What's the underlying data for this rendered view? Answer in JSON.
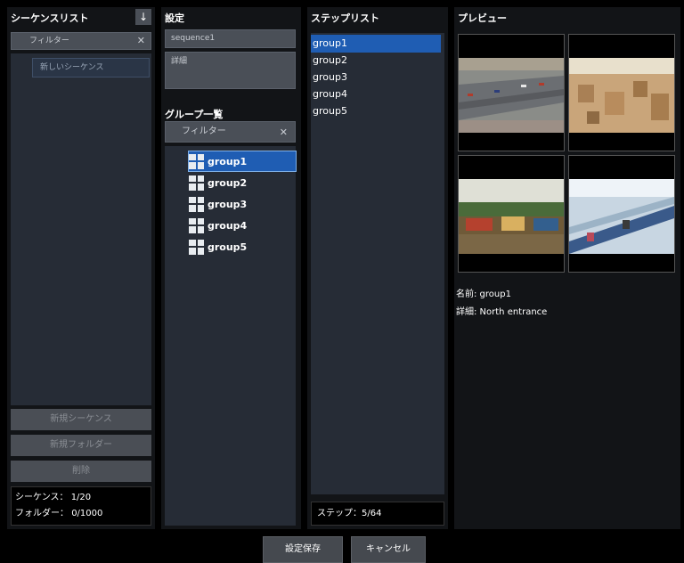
{
  "sequence_panel": {
    "title": "シーケンスリスト",
    "filter_placeholder": "フィルター",
    "new_sequence_item": "新しいシーケンス",
    "btn_new_sequence": "新規シーケンス",
    "btn_new_folder": "新規フォルダー",
    "btn_delete": "削除",
    "sequence_count_label": "シーケンス：",
    "sequence_count": "1/20",
    "folder_count_label": "フォルダー：",
    "folder_count": "0/1000"
  },
  "settings_panel": {
    "title": "設定",
    "name_value": "sequence1",
    "detail_placeholder": "詳細",
    "group_list_title": "グループ一覧",
    "filter_placeholder": "フィルター",
    "groups": [
      "group1",
      "group2",
      "group3",
      "group4",
      "group5"
    ]
  },
  "step_panel": {
    "title": "ステップリスト",
    "steps": [
      "group1",
      "group2",
      "group3",
      "group4",
      "group5"
    ],
    "step_count": "ステップ：5/64"
  },
  "preview_panel": {
    "title": "プレビュー",
    "name_line": "名前: group1",
    "detail_line": "詳細: North entrance"
  },
  "footer": {
    "save": "設定保存",
    "cancel": "キャンセル"
  },
  "colors": {
    "selected": "#1f5db3",
    "panel": "#121417",
    "list": "#262c36"
  }
}
